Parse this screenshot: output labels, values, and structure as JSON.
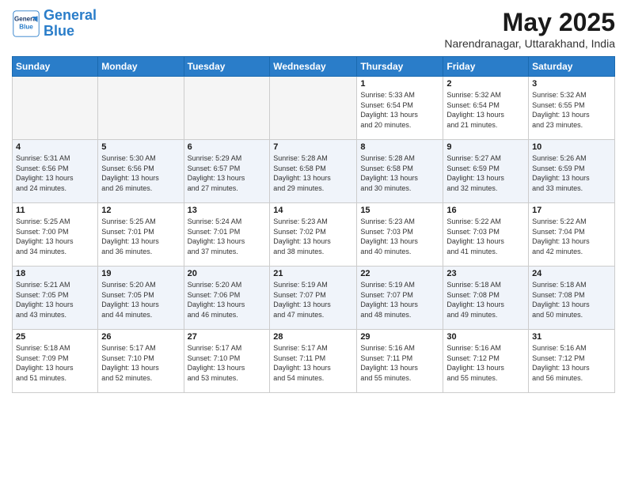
{
  "header": {
    "logo_line1": "General",
    "logo_line2": "Blue",
    "month_title": "May 2025",
    "location": "Narendranagar, Uttarakhand, India"
  },
  "weekdays": [
    "Sunday",
    "Monday",
    "Tuesday",
    "Wednesday",
    "Thursday",
    "Friday",
    "Saturday"
  ],
  "weeks": [
    [
      {
        "day": "",
        "info": ""
      },
      {
        "day": "",
        "info": ""
      },
      {
        "day": "",
        "info": ""
      },
      {
        "day": "",
        "info": ""
      },
      {
        "day": "1",
        "info": "Sunrise: 5:33 AM\nSunset: 6:54 PM\nDaylight: 13 hours\nand 20 minutes."
      },
      {
        "day": "2",
        "info": "Sunrise: 5:32 AM\nSunset: 6:54 PM\nDaylight: 13 hours\nand 21 minutes."
      },
      {
        "day": "3",
        "info": "Sunrise: 5:32 AM\nSunset: 6:55 PM\nDaylight: 13 hours\nand 23 minutes."
      }
    ],
    [
      {
        "day": "4",
        "info": "Sunrise: 5:31 AM\nSunset: 6:56 PM\nDaylight: 13 hours\nand 24 minutes."
      },
      {
        "day": "5",
        "info": "Sunrise: 5:30 AM\nSunset: 6:56 PM\nDaylight: 13 hours\nand 26 minutes."
      },
      {
        "day": "6",
        "info": "Sunrise: 5:29 AM\nSunset: 6:57 PM\nDaylight: 13 hours\nand 27 minutes."
      },
      {
        "day": "7",
        "info": "Sunrise: 5:28 AM\nSunset: 6:58 PM\nDaylight: 13 hours\nand 29 minutes."
      },
      {
        "day": "8",
        "info": "Sunrise: 5:28 AM\nSunset: 6:58 PM\nDaylight: 13 hours\nand 30 minutes."
      },
      {
        "day": "9",
        "info": "Sunrise: 5:27 AM\nSunset: 6:59 PM\nDaylight: 13 hours\nand 32 minutes."
      },
      {
        "day": "10",
        "info": "Sunrise: 5:26 AM\nSunset: 6:59 PM\nDaylight: 13 hours\nand 33 minutes."
      }
    ],
    [
      {
        "day": "11",
        "info": "Sunrise: 5:25 AM\nSunset: 7:00 PM\nDaylight: 13 hours\nand 34 minutes."
      },
      {
        "day": "12",
        "info": "Sunrise: 5:25 AM\nSunset: 7:01 PM\nDaylight: 13 hours\nand 36 minutes."
      },
      {
        "day": "13",
        "info": "Sunrise: 5:24 AM\nSunset: 7:01 PM\nDaylight: 13 hours\nand 37 minutes."
      },
      {
        "day": "14",
        "info": "Sunrise: 5:23 AM\nSunset: 7:02 PM\nDaylight: 13 hours\nand 38 minutes."
      },
      {
        "day": "15",
        "info": "Sunrise: 5:23 AM\nSunset: 7:03 PM\nDaylight: 13 hours\nand 40 minutes."
      },
      {
        "day": "16",
        "info": "Sunrise: 5:22 AM\nSunset: 7:03 PM\nDaylight: 13 hours\nand 41 minutes."
      },
      {
        "day": "17",
        "info": "Sunrise: 5:22 AM\nSunset: 7:04 PM\nDaylight: 13 hours\nand 42 minutes."
      }
    ],
    [
      {
        "day": "18",
        "info": "Sunrise: 5:21 AM\nSunset: 7:05 PM\nDaylight: 13 hours\nand 43 minutes."
      },
      {
        "day": "19",
        "info": "Sunrise: 5:20 AM\nSunset: 7:05 PM\nDaylight: 13 hours\nand 44 minutes."
      },
      {
        "day": "20",
        "info": "Sunrise: 5:20 AM\nSunset: 7:06 PM\nDaylight: 13 hours\nand 46 minutes."
      },
      {
        "day": "21",
        "info": "Sunrise: 5:19 AM\nSunset: 7:07 PM\nDaylight: 13 hours\nand 47 minutes."
      },
      {
        "day": "22",
        "info": "Sunrise: 5:19 AM\nSunset: 7:07 PM\nDaylight: 13 hours\nand 48 minutes."
      },
      {
        "day": "23",
        "info": "Sunrise: 5:18 AM\nSunset: 7:08 PM\nDaylight: 13 hours\nand 49 minutes."
      },
      {
        "day": "24",
        "info": "Sunrise: 5:18 AM\nSunset: 7:08 PM\nDaylight: 13 hours\nand 50 minutes."
      }
    ],
    [
      {
        "day": "25",
        "info": "Sunrise: 5:18 AM\nSunset: 7:09 PM\nDaylight: 13 hours\nand 51 minutes."
      },
      {
        "day": "26",
        "info": "Sunrise: 5:17 AM\nSunset: 7:10 PM\nDaylight: 13 hours\nand 52 minutes."
      },
      {
        "day": "27",
        "info": "Sunrise: 5:17 AM\nSunset: 7:10 PM\nDaylight: 13 hours\nand 53 minutes."
      },
      {
        "day": "28",
        "info": "Sunrise: 5:17 AM\nSunset: 7:11 PM\nDaylight: 13 hours\nand 54 minutes."
      },
      {
        "day": "29",
        "info": "Sunrise: 5:16 AM\nSunset: 7:11 PM\nDaylight: 13 hours\nand 55 minutes."
      },
      {
        "day": "30",
        "info": "Sunrise: 5:16 AM\nSunset: 7:12 PM\nDaylight: 13 hours\nand 55 minutes."
      },
      {
        "day": "31",
        "info": "Sunrise: 5:16 AM\nSunset: 7:12 PM\nDaylight: 13 hours\nand 56 minutes."
      }
    ]
  ]
}
